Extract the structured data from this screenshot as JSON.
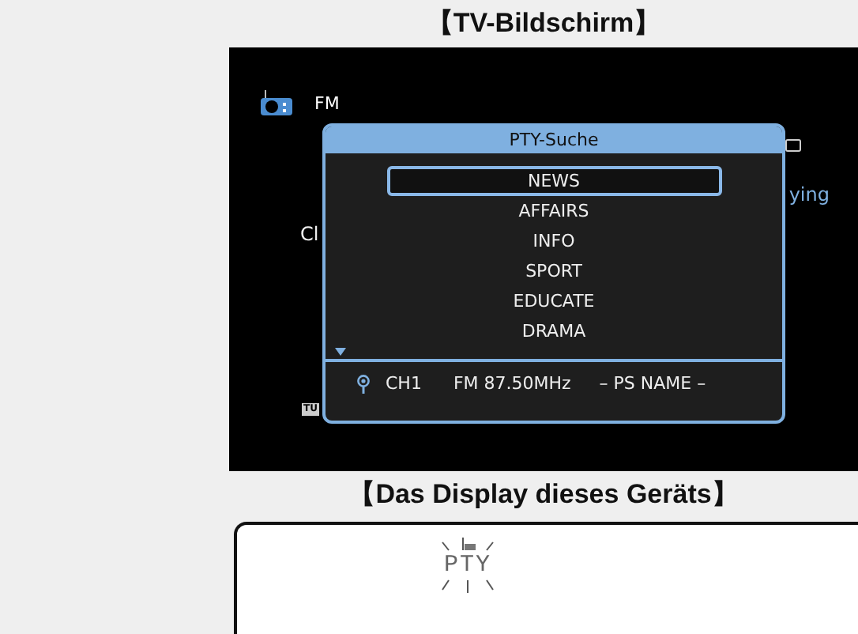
{
  "tv_heading": "【TV-Bildschirm】",
  "tv_screen": {
    "source": "FM",
    "fragment_left": "Cl",
    "fragment_right": "ying",
    "badge": "TU",
    "popup": {
      "title": "PTY-Suche",
      "items": [
        {
          "label": "NEWS",
          "selected": true
        },
        {
          "label": "AFFAIRS",
          "selected": false
        },
        {
          "label": "INFO",
          "selected": false
        },
        {
          "label": "SPORT",
          "selected": false
        },
        {
          "label": "EDUCATE",
          "selected": false
        },
        {
          "label": "DRAMA",
          "selected": false
        }
      ],
      "footer": {
        "channel": "CH1",
        "frequency": "FM 87.50MHz",
        "ps_name": "– PS NAME –"
      }
    }
  },
  "display_heading": "【Das Display dieses Geräts】",
  "display": {
    "text": "PTY"
  }
}
